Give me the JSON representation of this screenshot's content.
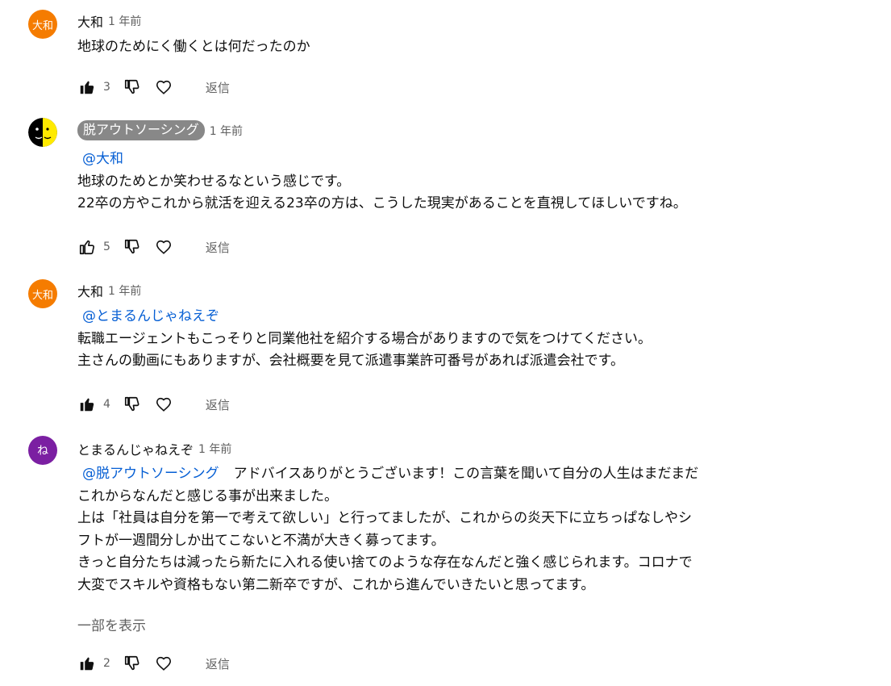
{
  "comments": [
    {
      "author": "大和",
      "avatar_text": "大和",
      "time": "1 年前",
      "lines": [
        "地球のためにく働くとは何だったのか"
      ],
      "likes": "3",
      "liked": true,
      "reply_label": "返信"
    },
    {
      "author": "脱アウトソーシング",
      "time": "1 年前",
      "mention": "@大和",
      "lines": [
        "地球のためとか笑わせるなという感じです。",
        "22卒の方やこれから就活を迎える23卒の方は、こうした現実があることを直視してほしいですね。"
      ],
      "likes": "5",
      "liked": false,
      "reply_label": "返信"
    },
    {
      "author": "大和",
      "avatar_text": "大和",
      "time": "1 年前",
      "mention": "@とまるんじゃねえぞ",
      "lines": [
        "転職エージェントもこっそりと同業他社を紹介する場合がありますので気をつけてください。",
        "主さんの動画にもありますが、会社概要を見て派遣事業許可番号があれば派遣会社です。"
      ],
      "likes": "4",
      "liked": true,
      "reply_label": "返信"
    },
    {
      "author": "とまるんじゃねえぞ",
      "avatar_text": "ね",
      "time": "1 年前",
      "mention": "@脱アウトソーシング",
      "first_line_rest": "アドバイスありがとうございます！この言葉を聞いて自分の人生はまだまだ",
      "lines": [
        "これからなんだと感じる事が出来ました。",
        "上は「社員は自分を第一で考えて欲しい」と行ってましたが、これからの炎天下に立ちっぱなしやシ",
        "フトが一週間分しか出てこないと不満が大きく募ってます。",
        "きっと自分たちは減ったら新たに入れる使い捨てのような存在なんだと強く感じられます。コロナで",
        "大変でスキルや資格もない第二新卒ですが、これから進んでいきたいと思ってます。"
      ],
      "show_more": "一部を表示",
      "likes": "2",
      "liked": true,
      "reply_label": "返信"
    }
  ],
  "colors": {
    "text": "#0f0f0f",
    "secondary": "#606060",
    "mention": "#065fd4",
    "avatar_orange": "#f57c00",
    "avatar_purple": "#7b1fa2",
    "chip": "#888888"
  },
  "icons": [
    "thumb-up-icon",
    "thumb-down-icon",
    "heart-icon"
  ]
}
